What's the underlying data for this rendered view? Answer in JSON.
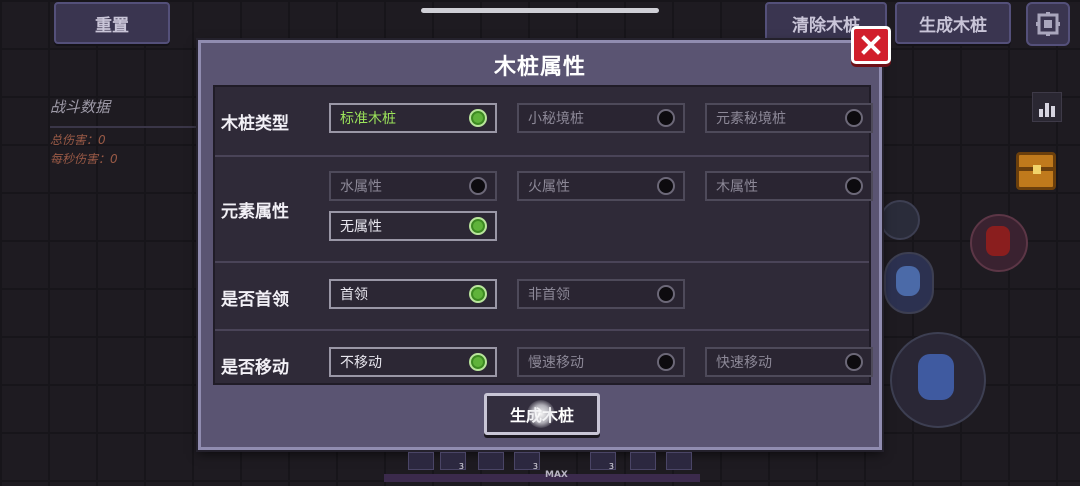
{
  "hud": {
    "reset_label": "重置",
    "clear_label": "清除木桩",
    "generate_label": "生成木桩"
  },
  "stats": {
    "title": "战斗数据",
    "total_damage": "总伤害：0",
    "dps": "每秒伤害：0"
  },
  "dialog": {
    "title": "木桩属性",
    "generate_button": "生成木桩",
    "rows": [
      {
        "label": "木桩类型",
        "options": [
          {
            "label": "标准木桩",
            "selected": true
          },
          {
            "label": "小秘境桩",
            "selected": false
          },
          {
            "label": "元素秘境桩",
            "selected": false
          }
        ]
      },
      {
        "label": "元素属性",
        "options": [
          {
            "label": "水属性",
            "selected": false
          },
          {
            "label": "火属性",
            "selected": false
          },
          {
            "label": "木属性",
            "selected": false
          },
          {
            "label": "无属性",
            "selected": true
          }
        ]
      },
      {
        "label": "是否首领",
        "options": [
          {
            "label": "首领",
            "selected": true
          },
          {
            "label": "非首领",
            "selected": false
          }
        ]
      },
      {
        "label": "是否移动",
        "options": [
          {
            "label": "不移动",
            "selected": true
          },
          {
            "label": "慢速移动",
            "selected": false
          },
          {
            "label": "快速移动",
            "selected": false
          }
        ]
      }
    ]
  },
  "bottom": {
    "max_label": "MAX",
    "slot_counts": [
      "3",
      "3",
      "3"
    ]
  },
  "colors": {
    "selected_radio": "#5fb33a",
    "accent_text": "#9be35a",
    "close_button": "#d11f2c",
    "panel": "#5a5472"
  }
}
